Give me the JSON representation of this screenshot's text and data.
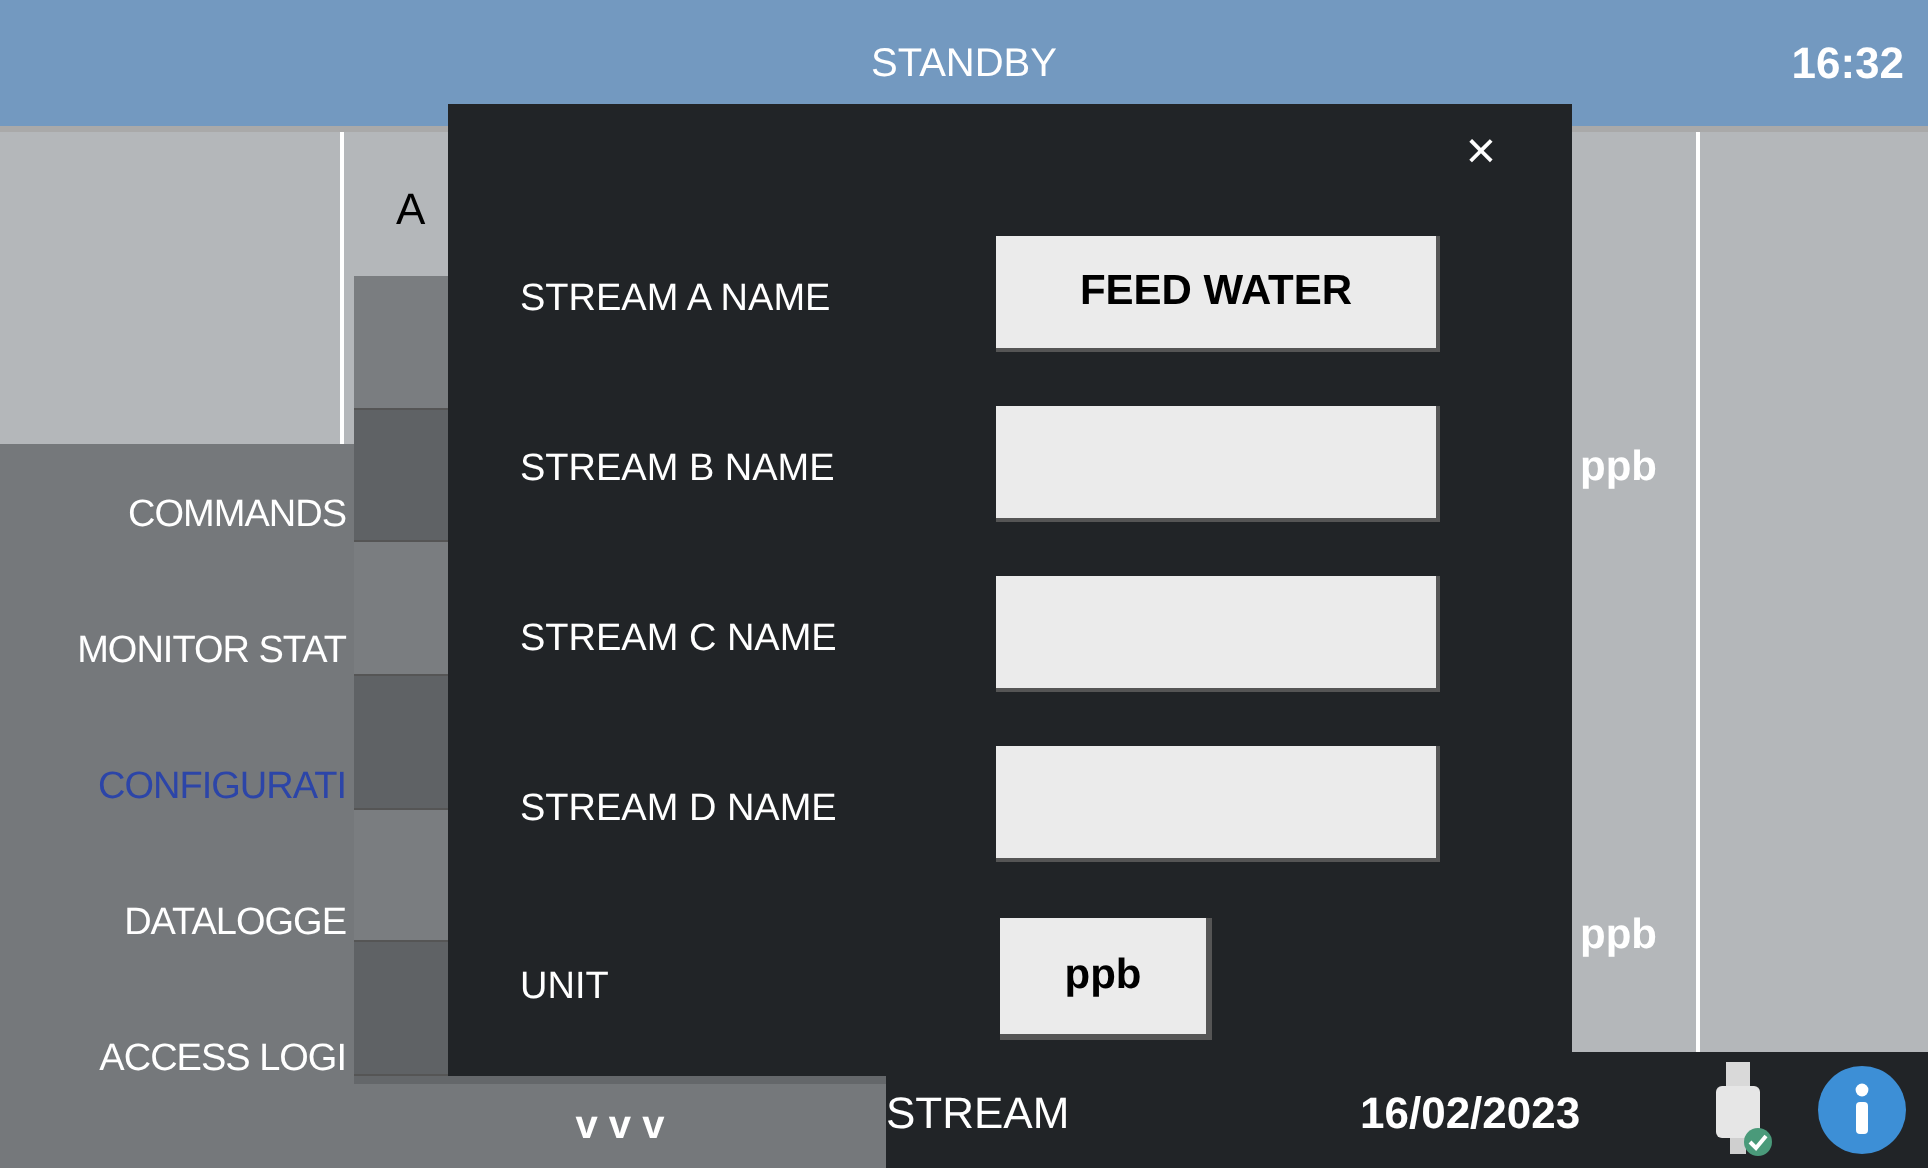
{
  "header": {
    "title": "STANDBY",
    "time": "16:32"
  },
  "background": {
    "stream_label": "A",
    "units": [
      "ppb",
      "ppb"
    ]
  },
  "menu": {
    "items": [
      {
        "label": "COMMANDS",
        "selected": false
      },
      {
        "label": "MONITOR STAT",
        "selected": false
      },
      {
        "label": "CONFIGURATI",
        "selected": true
      },
      {
        "label": "DATALOGGE",
        "selected": false
      },
      {
        "label": "ACCESS LOGI",
        "selected": false
      }
    ],
    "scroll_label": "v v v"
  },
  "dialog": {
    "close": "×",
    "fields": [
      {
        "label": "STREAM A NAME",
        "value": "FEED WATER"
      },
      {
        "label": "STREAM B NAME"
      },
      {
        "label": "STREAM C NAME"
      },
      {
        "label": "STREAM D NAME"
      }
    ],
    "unit": {
      "label": "UNIT",
      "value": "ppb"
    }
  },
  "status_bar": {
    "stream": "STREAM",
    "date": "16/02/2023"
  }
}
